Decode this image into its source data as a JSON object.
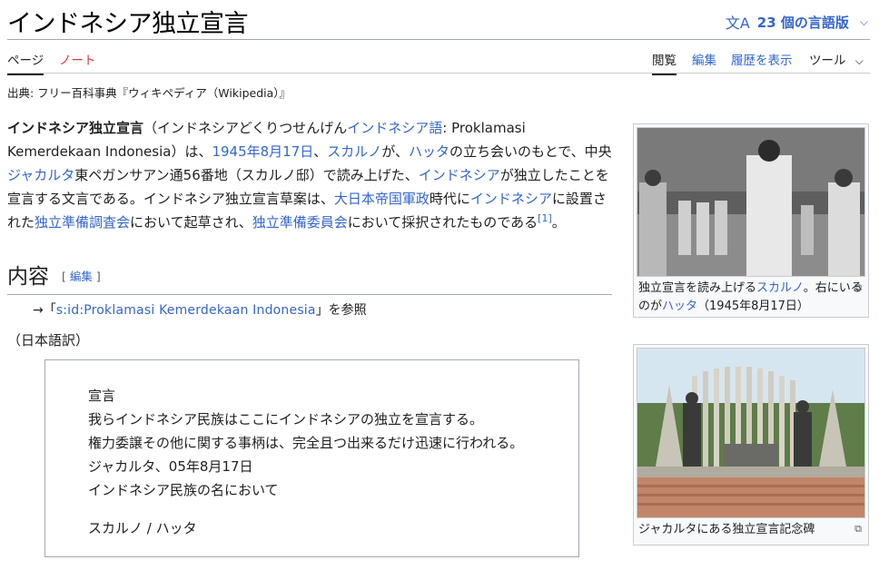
{
  "page": {
    "title": "インドネシア独立宣言",
    "languages": "23 個の言語版",
    "site_sub": "出典: フリー百科事典『ウィキペディア（Wikipedia）』"
  },
  "tabs": {
    "page": "ページ",
    "talk": "ノート",
    "read": "閲覧",
    "edit": "編集",
    "history": "履歴を表示",
    "tools": "ツール"
  },
  "lead": {
    "term": "インドネシア独立宣言",
    "reading": "（インドネシアどくりつせんげん",
    "lang_link": "インドネシア語",
    "lang_sep": ": ",
    "original": "Proklamasi Kemerdekaan Indonesia",
    "t1": "）は、",
    "date_link": "1945年8月17日",
    "t2": "、",
    "soekarno": "スカルノ",
    "t3": "が、",
    "hatta": "ハッタ",
    "t4": "の立ち会いのもとで、中央",
    "jakarta": "ジャカルタ",
    "t5": "東ペガンサアン通56番地（スカルノ邸）で読み上げた、",
    "indonesia1": "インドネシア",
    "t6": "が独立したことを宣言する文言である。インドネシア独立宣言草案は、",
    "army": "大日本帝国軍政",
    "t7": "時代に",
    "indonesia2": "インドネシア",
    "t8": "に設置された",
    "bpupki": "独立準備調査会",
    "t9": "において起草され、",
    "ppki": "独立準備委員会",
    "t10": "において採択されたものである",
    "ref": "[1]",
    "t11": "。"
  },
  "section": {
    "heading": "内容",
    "edit_open": "[",
    "edit": "編集",
    "edit_close": "]"
  },
  "hatnote": {
    "arrow": "→「",
    "link": "s:id:Proklamasi Kemerdekaan Indonesia",
    "suffix": "」を参照"
  },
  "translation_label": "（日本語訳）",
  "declaration": {
    "line1": "宣言",
    "line2": "我らインドネシア民族はここにインドネシアの独立を宣言する。",
    "line3": "権力委譲その他に関する事柄は、完全且つ出来るだけ迅速に行われる。",
    "line4": "ジャカルタ、05年8月17日",
    "line5": "インドネシア民族の名において",
    "line6": "スカルノ / ハッタ"
  },
  "thumb1": {
    "cap1": "独立宣言を読み上げる",
    "cap_link1": "スカルノ",
    "cap2": "。右にいるのが",
    "cap_link2": "ハッタ",
    "cap3": "（1945年8月17日）"
  },
  "thumb2": {
    "cap": "ジャカルタにある独立宣言記念碑"
  },
  "icons": {
    "translate": "文A",
    "chevron": "⌵",
    "enlarge": "⧉"
  },
  "colors": {
    "link": "#3366cc",
    "talk": "#dd3333"
  }
}
